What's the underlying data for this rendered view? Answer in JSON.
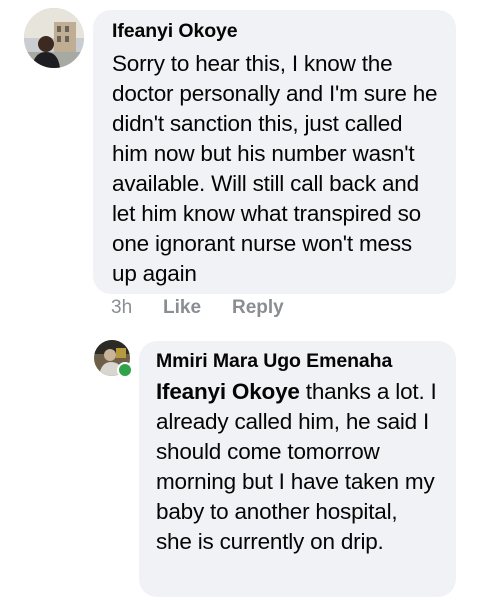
{
  "comments": [
    {
      "author": "Ifeanyi Okoye",
      "text": "Sorry to hear this, I know the doctor personally and I'm sure he didn't sanction this, just called him now but his number wasn't available. Will still call back and let him know what transpired so one ignorant nurse won't mess up again",
      "time": "3h",
      "like_label": "Like",
      "reply_label": "Reply"
    }
  ],
  "reply": {
    "author": "Mmiri Mara Ugo Emenaha",
    "mention": "Ifeanyi Okoye",
    "text": " thanks a lot. I already called him, he said I should come tomorrow morning but I have taken my baby to another hospital, she is currently on drip.",
    "online": true
  },
  "colors": {
    "bubble": "#f0f2f5",
    "text": "#050505",
    "meta": "#8a8d91",
    "online": "#31a24c"
  },
  "icons": [
    "avatar-photo",
    "online-status-indicator"
  ]
}
